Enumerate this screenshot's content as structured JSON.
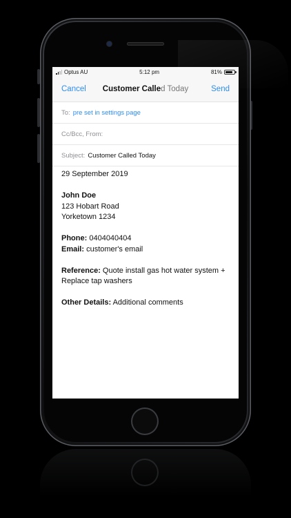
{
  "status_bar": {
    "carrier": "Optus AU",
    "time": "5:12 pm",
    "battery": "81%",
    "battery_level": 0.81
  },
  "nav": {
    "cancel_label": "Cancel",
    "title_main": "Customer Calle",
    "title_fade": "d Today",
    "send_label": "Send"
  },
  "fields": {
    "to_label": "To:",
    "to_value": "pre set in settings page",
    "ccbcc_label": "Cc/Bcc, From:",
    "subject_label": "Subject:",
    "subject_value": "Customer Called Today"
  },
  "body": {
    "date": "29 September 2019",
    "name": "John Doe",
    "address_line1": "123 Hobart Road",
    "address_line2": "Yorketown 1234",
    "phone_label": "Phone:",
    "phone_value": "0404040404",
    "email_label": "Email:",
    "email_value": "customer's email",
    "reference_label": "Reference:",
    "reference_value": "Quote install gas hot water system + Replace tap washers",
    "other_label": "Other Details:",
    "other_value": "Additional comments"
  },
  "icons": {
    "signal": "cellular-signal-icon",
    "battery": "battery-icon",
    "camera": "front-camera-icon",
    "home": "home-button-icon"
  },
  "colors": {
    "accent": "#2e8cf0",
    "label_gray": "#8e8e93"
  }
}
